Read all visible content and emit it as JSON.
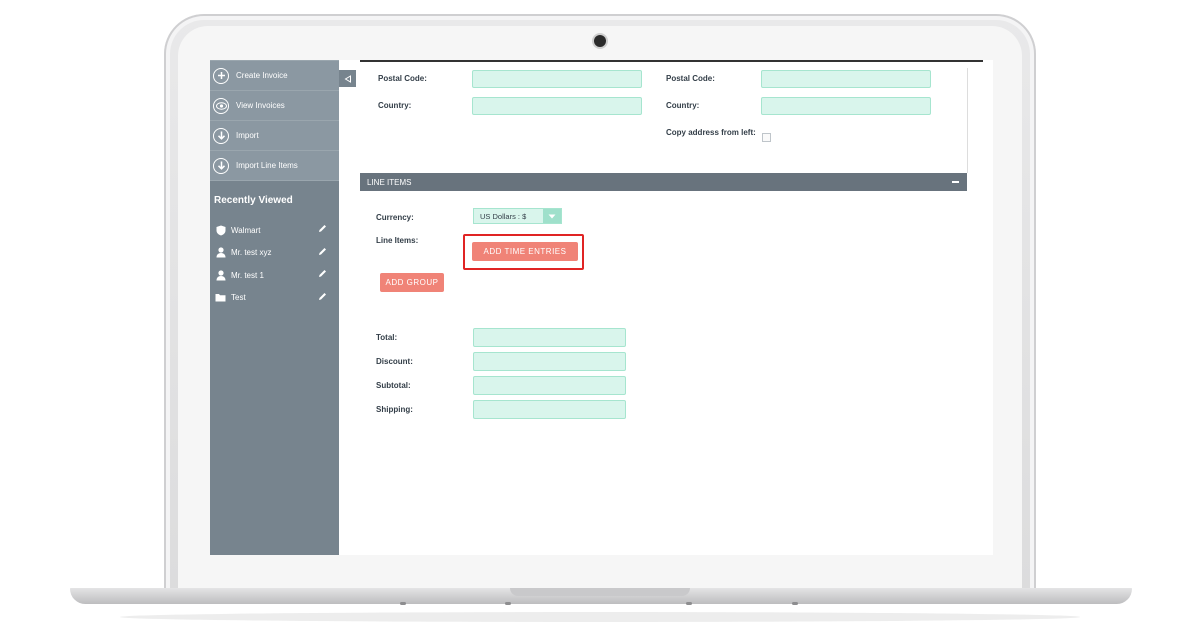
{
  "sidebar": {
    "actions": [
      {
        "label": "Create Invoice",
        "icon": "plus-icon"
      },
      {
        "label": "View Invoices",
        "icon": "eye-icon"
      },
      {
        "label": "Import",
        "icon": "download-icon"
      },
      {
        "label": "Import Line Items",
        "icon": "download-icon"
      }
    ],
    "recently_viewed_title": "Recently Viewed",
    "recent_items": [
      {
        "label": "Walmart",
        "icon": "shield-icon"
      },
      {
        "label": "Mr. test xyz",
        "icon": "person-icon"
      },
      {
        "label": "Mr. test 1",
        "icon": "person-icon"
      },
      {
        "label": "Test",
        "icon": "folder-icon"
      }
    ]
  },
  "address": {
    "left_postal_label": "Postal Code:",
    "left_country_label": "Country:",
    "right_postal_label": "Postal Code:",
    "right_country_label": "Country:",
    "copy_address_label": "Copy address from left:",
    "copy_address_checked": false
  },
  "line_items": {
    "panel_title": "LINE ITEMS",
    "currency_label": "Currency:",
    "currency_value": "US Dollars : $",
    "line_items_label": "Line Items:",
    "add_time_entries_label": "ADD TIME ENTRIES",
    "add_group_label": "ADD GROUP"
  },
  "totals": {
    "total_label": "Total:",
    "discount_label": "Discount:",
    "subtotal_label": "Subtotal:",
    "shipping_label": "Shipping:"
  },
  "colors": {
    "sidebar": "#77848e",
    "field_bg": "#d9f5ec",
    "field_border": "#a6e5cf",
    "button": "#f08377",
    "highlight": "#e02424",
    "panel_header": "#68737d"
  }
}
